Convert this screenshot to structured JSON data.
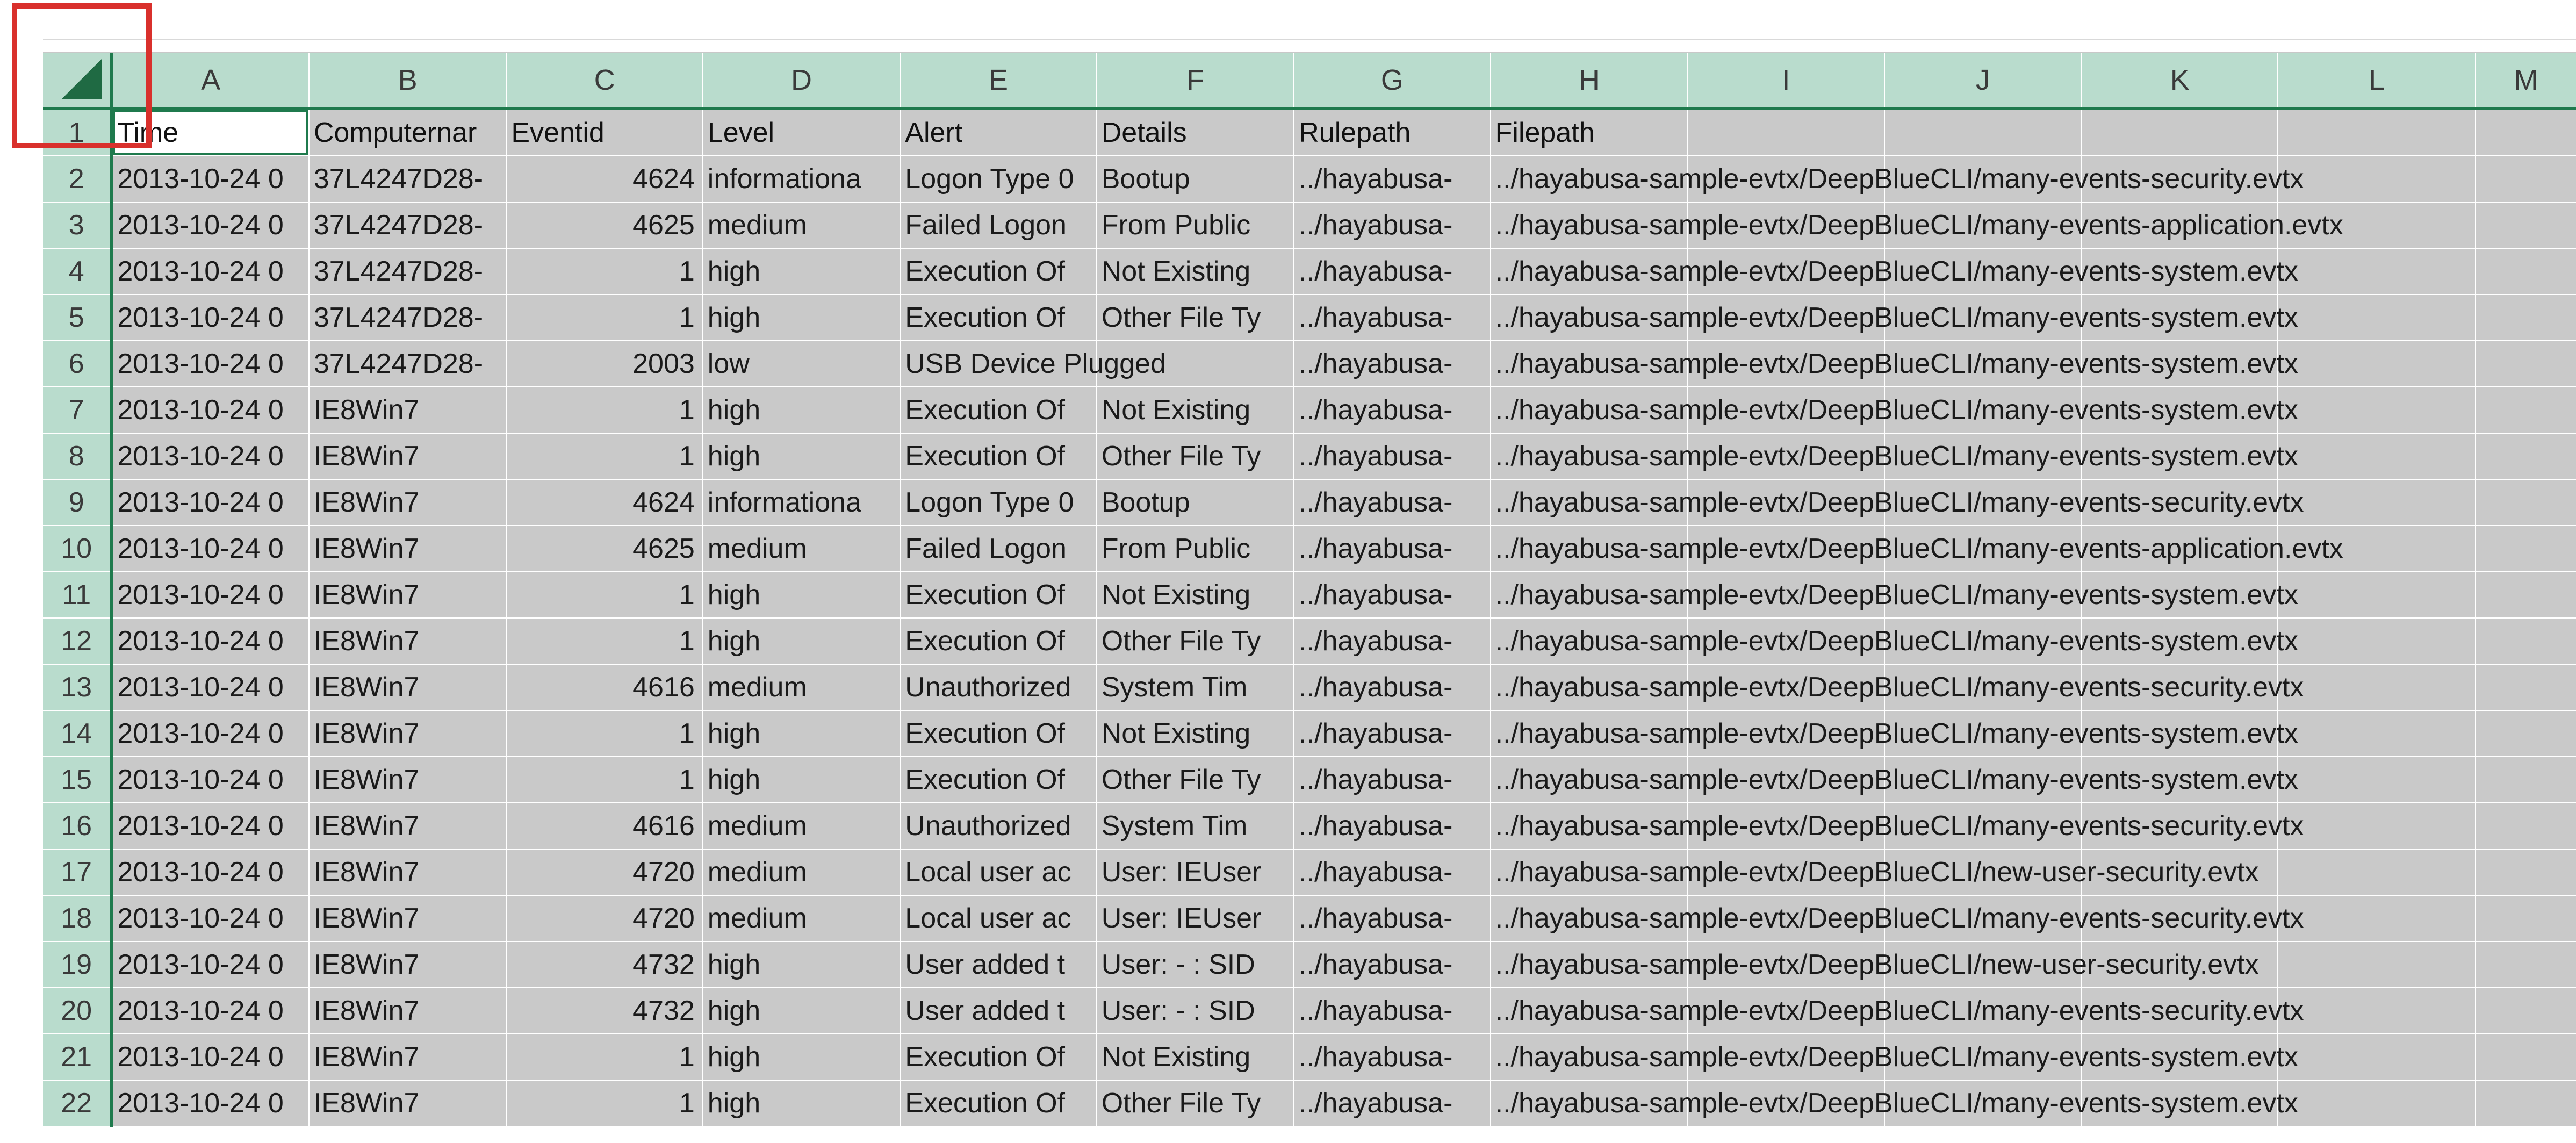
{
  "column_headers": [
    "A",
    "B",
    "C",
    "D",
    "E",
    "F",
    "G",
    "H",
    "I",
    "J",
    "K",
    "L",
    "M"
  ],
  "row_numbers": [
    "1",
    "2",
    "3",
    "4",
    "5",
    "6",
    "7",
    "8",
    "9",
    "10",
    "11",
    "12",
    "13",
    "14",
    "15",
    "16",
    "17",
    "18",
    "19",
    "20",
    "21",
    "22"
  ],
  "colors": {
    "header_bg": "#b9dccd",
    "header_accent": "#1f7a4d",
    "cell_bg": "#c9c9c9",
    "highlight": "#d9302c"
  },
  "header_row": {
    "A": "Time",
    "B": "Computernar",
    "C": "Eventid",
    "D": "Level",
    "E": "Alert",
    "F": "Details",
    "G": "Rulepath",
    "H": "Filepath"
  },
  "rows": [
    {
      "time": "2013-10-24 0",
      "computer": "37L4247D28-",
      "eventid": "4624",
      "level": "informationa",
      "alert": "Logon Type 0",
      "details": "Bootup",
      "rulepath": "../hayabusa-",
      "filepath": "../hayabusa-sample-evtx/DeepBlueCLI/many-events-security.evtx"
    },
    {
      "time": "2013-10-24 0",
      "computer": "37L4247D28-",
      "eventid": "4625",
      "level": "medium",
      "alert": "Failed Logon",
      "details": "From Public",
      "rulepath": "../hayabusa-",
      "filepath": "../hayabusa-sample-evtx/DeepBlueCLI/many-events-application.evtx"
    },
    {
      "time": "2013-10-24 0",
      "computer": "37L4247D28-",
      "eventid": "1",
      "level": "high",
      "alert": "Execution Of",
      "details": "Not Existing",
      "rulepath": "../hayabusa-",
      "filepath": "../hayabusa-sample-evtx/DeepBlueCLI/many-events-system.evtx"
    },
    {
      "time": "2013-10-24 0",
      "computer": "37L4247D28-",
      "eventid": "1",
      "level": "high",
      "alert": "Execution Of",
      "details": "Other File Ty",
      "rulepath": "../hayabusa-",
      "filepath": "../hayabusa-sample-evtx/DeepBlueCLI/many-events-system.evtx"
    },
    {
      "time": "2013-10-24 0",
      "computer": "37L4247D28-",
      "eventid": "2003",
      "level": "low",
      "alert": "USB Device Plugged",
      "details": "",
      "rulepath": "../hayabusa-",
      "filepath": "../hayabusa-sample-evtx/DeepBlueCLI/many-events-system.evtx"
    },
    {
      "time": "2013-10-24 0",
      "computer": "IE8Win7",
      "eventid": "1",
      "level": "high",
      "alert": "Execution Of",
      "details": "Not Existing",
      "rulepath": "../hayabusa-",
      "filepath": "../hayabusa-sample-evtx/DeepBlueCLI/many-events-system.evtx"
    },
    {
      "time": "2013-10-24 0",
      "computer": "IE8Win7",
      "eventid": "1",
      "level": "high",
      "alert": "Execution Of",
      "details": "Other File Ty",
      "rulepath": "../hayabusa-",
      "filepath": "../hayabusa-sample-evtx/DeepBlueCLI/many-events-system.evtx"
    },
    {
      "time": "2013-10-24 0",
      "computer": "IE8Win7",
      "eventid": "4624",
      "level": "informationa",
      "alert": "Logon Type 0",
      "details": "Bootup",
      "rulepath": "../hayabusa-",
      "filepath": "../hayabusa-sample-evtx/DeepBlueCLI/many-events-security.evtx"
    },
    {
      "time": "2013-10-24 0",
      "computer": "IE8Win7",
      "eventid": "4625",
      "level": "medium",
      "alert": "Failed Logon",
      "details": "From Public",
      "rulepath": "../hayabusa-",
      "filepath": "../hayabusa-sample-evtx/DeepBlueCLI/many-events-application.evtx"
    },
    {
      "time": "2013-10-24 0",
      "computer": "IE8Win7",
      "eventid": "1",
      "level": "high",
      "alert": "Execution Of",
      "details": "Not Existing",
      "rulepath": "../hayabusa-",
      "filepath": "../hayabusa-sample-evtx/DeepBlueCLI/many-events-system.evtx"
    },
    {
      "time": "2013-10-24 0",
      "computer": "IE8Win7",
      "eventid": "1",
      "level": "high",
      "alert": "Execution Of",
      "details": "Other File Ty",
      "rulepath": "../hayabusa-",
      "filepath": "../hayabusa-sample-evtx/DeepBlueCLI/many-events-system.evtx"
    },
    {
      "time": "2013-10-24 0",
      "computer": "IE8Win7",
      "eventid": "4616",
      "level": "medium",
      "alert": "Unauthorized",
      "details": "System Tim",
      "rulepath": "../hayabusa-",
      "filepath": "../hayabusa-sample-evtx/DeepBlueCLI/many-events-security.evtx"
    },
    {
      "time": "2013-10-24 0",
      "computer": "IE8Win7",
      "eventid": "1",
      "level": "high",
      "alert": "Execution Of",
      "details": "Not Existing",
      "rulepath": "../hayabusa-",
      "filepath": "../hayabusa-sample-evtx/DeepBlueCLI/many-events-system.evtx"
    },
    {
      "time": "2013-10-24 0",
      "computer": "IE8Win7",
      "eventid": "1",
      "level": "high",
      "alert": "Execution Of",
      "details": "Other File Ty",
      "rulepath": "../hayabusa-",
      "filepath": "../hayabusa-sample-evtx/DeepBlueCLI/many-events-system.evtx"
    },
    {
      "time": "2013-10-24 0",
      "computer": "IE8Win7",
      "eventid": "4616",
      "level": "medium",
      "alert": "Unauthorized",
      "details": "System Tim",
      "rulepath": "../hayabusa-",
      "filepath": "../hayabusa-sample-evtx/DeepBlueCLI/many-events-security.evtx"
    },
    {
      "time": "2013-10-24 0",
      "computer": "IE8Win7",
      "eventid": "4720",
      "level": "medium",
      "alert": "Local user ac",
      "details": "User: IEUser",
      "rulepath": "../hayabusa-",
      "filepath": "../hayabusa-sample-evtx/DeepBlueCLI/new-user-security.evtx"
    },
    {
      "time": "2013-10-24 0",
      "computer": "IE8Win7",
      "eventid": "4720",
      "level": "medium",
      "alert": "Local user ac",
      "details": "User: IEUser",
      "rulepath": "../hayabusa-",
      "filepath": "../hayabusa-sample-evtx/DeepBlueCLI/many-events-security.evtx"
    },
    {
      "time": "2013-10-24 0",
      "computer": "IE8Win7",
      "eventid": "4732",
      "level": "high",
      "alert": "User added t",
      "details": "User: -  :  SID",
      "rulepath": "../hayabusa-",
      "filepath": "../hayabusa-sample-evtx/DeepBlueCLI/new-user-security.evtx"
    },
    {
      "time": "2013-10-24 0",
      "computer": "IE8Win7",
      "eventid": "4732",
      "level": "high",
      "alert": "User added t",
      "details": "User: -  :  SID",
      "rulepath": "../hayabusa-",
      "filepath": "../hayabusa-sample-evtx/DeepBlueCLI/many-events-security.evtx"
    },
    {
      "time": "2013-10-24 0",
      "computer": "IE8Win7",
      "eventid": "1",
      "level": "high",
      "alert": "Execution Of",
      "details": "Not Existing",
      "rulepath": "../hayabusa-",
      "filepath": "../hayabusa-sample-evtx/DeepBlueCLI/many-events-system.evtx"
    },
    {
      "time": "2013-10-24 0",
      "computer": "IE8Win7",
      "eventid": "1",
      "level": "high",
      "alert": "Execution Of",
      "details": "Other File Ty",
      "rulepath": "../hayabusa-",
      "filepath": "../hayabusa-sample-evtx/DeepBlueCLI/many-events-system.evtx"
    }
  ]
}
